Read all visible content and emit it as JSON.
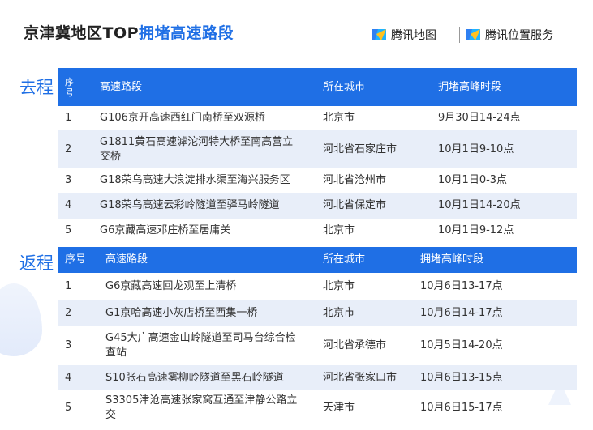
{
  "header": {
    "title_prefix": "京津冀地区TOP",
    "title_accent": "拥堵高速路段",
    "brand1": "腾讯地图",
    "brand2": "腾讯位置服务"
  },
  "colors": {
    "accent": "#1f6fe5",
    "row_alt": "#e8eef9"
  },
  "outbound": {
    "label": "去程",
    "headers": {
      "idx": "序\n号",
      "road": "高速路段",
      "city": "所在城市",
      "peak": "拥堵高峰时段"
    },
    "rows": [
      {
        "idx": "1",
        "road": "G106京开高速西红门南桥至双源桥",
        "city": "北京市",
        "peak": "9月30日14-24点"
      },
      {
        "idx": "2",
        "road": "G1811黄石高速滹沱河特大桥至南高营立\n交桥",
        "city": "河北省石家庄市",
        "peak": "10月1日9-10点"
      },
      {
        "idx": "3",
        "road": "G18荣乌高速大浪淀排水渠至海兴服务区",
        "city": "河北省沧州市",
        "peak": "10月1日0-3点"
      },
      {
        "idx": "4",
        "road": "G18荣乌高速云彩岭隧道至驿马岭隧道",
        "city": "河北省保定市",
        "peak": "10月1日14-20点"
      },
      {
        "idx": "5",
        "road": "G6京藏高速邓庄桥至居庸关",
        "city": "北京市",
        "peak": "10月1日9-12点"
      }
    ]
  },
  "return": {
    "label": "返程",
    "headers": {
      "idx": "序号",
      "road": "高速路段",
      "city": "所在城市",
      "peak": "拥堵高峰时段"
    },
    "rows": [
      {
        "idx": "1",
        "road": "G6京藏高速回龙观至上清桥",
        "city": "北京市",
        "peak": "10月6日13-17点"
      },
      {
        "idx": "2",
        "road": "G1京哈高速小灰店桥至西集一桥",
        "city": "北京市",
        "peak": "10月6日14-17点"
      },
      {
        "idx": "3",
        "road": "G45大广高速金山岭隧道至司马台综合检\n查站",
        "city": "河北省承德市",
        "peak": "10月5日14-20点"
      },
      {
        "idx": "4",
        "road": "S10张石高速雾柳岭隧道至黑石岭隧道",
        "city": "河北省张家口市",
        "peak": "10月6日13-15点"
      },
      {
        "idx": "5",
        "road": "S3305津沧高速张家窝互通至津静公路立\n交",
        "city": "天津市",
        "peak": "10月6日15-17点"
      }
    ]
  }
}
